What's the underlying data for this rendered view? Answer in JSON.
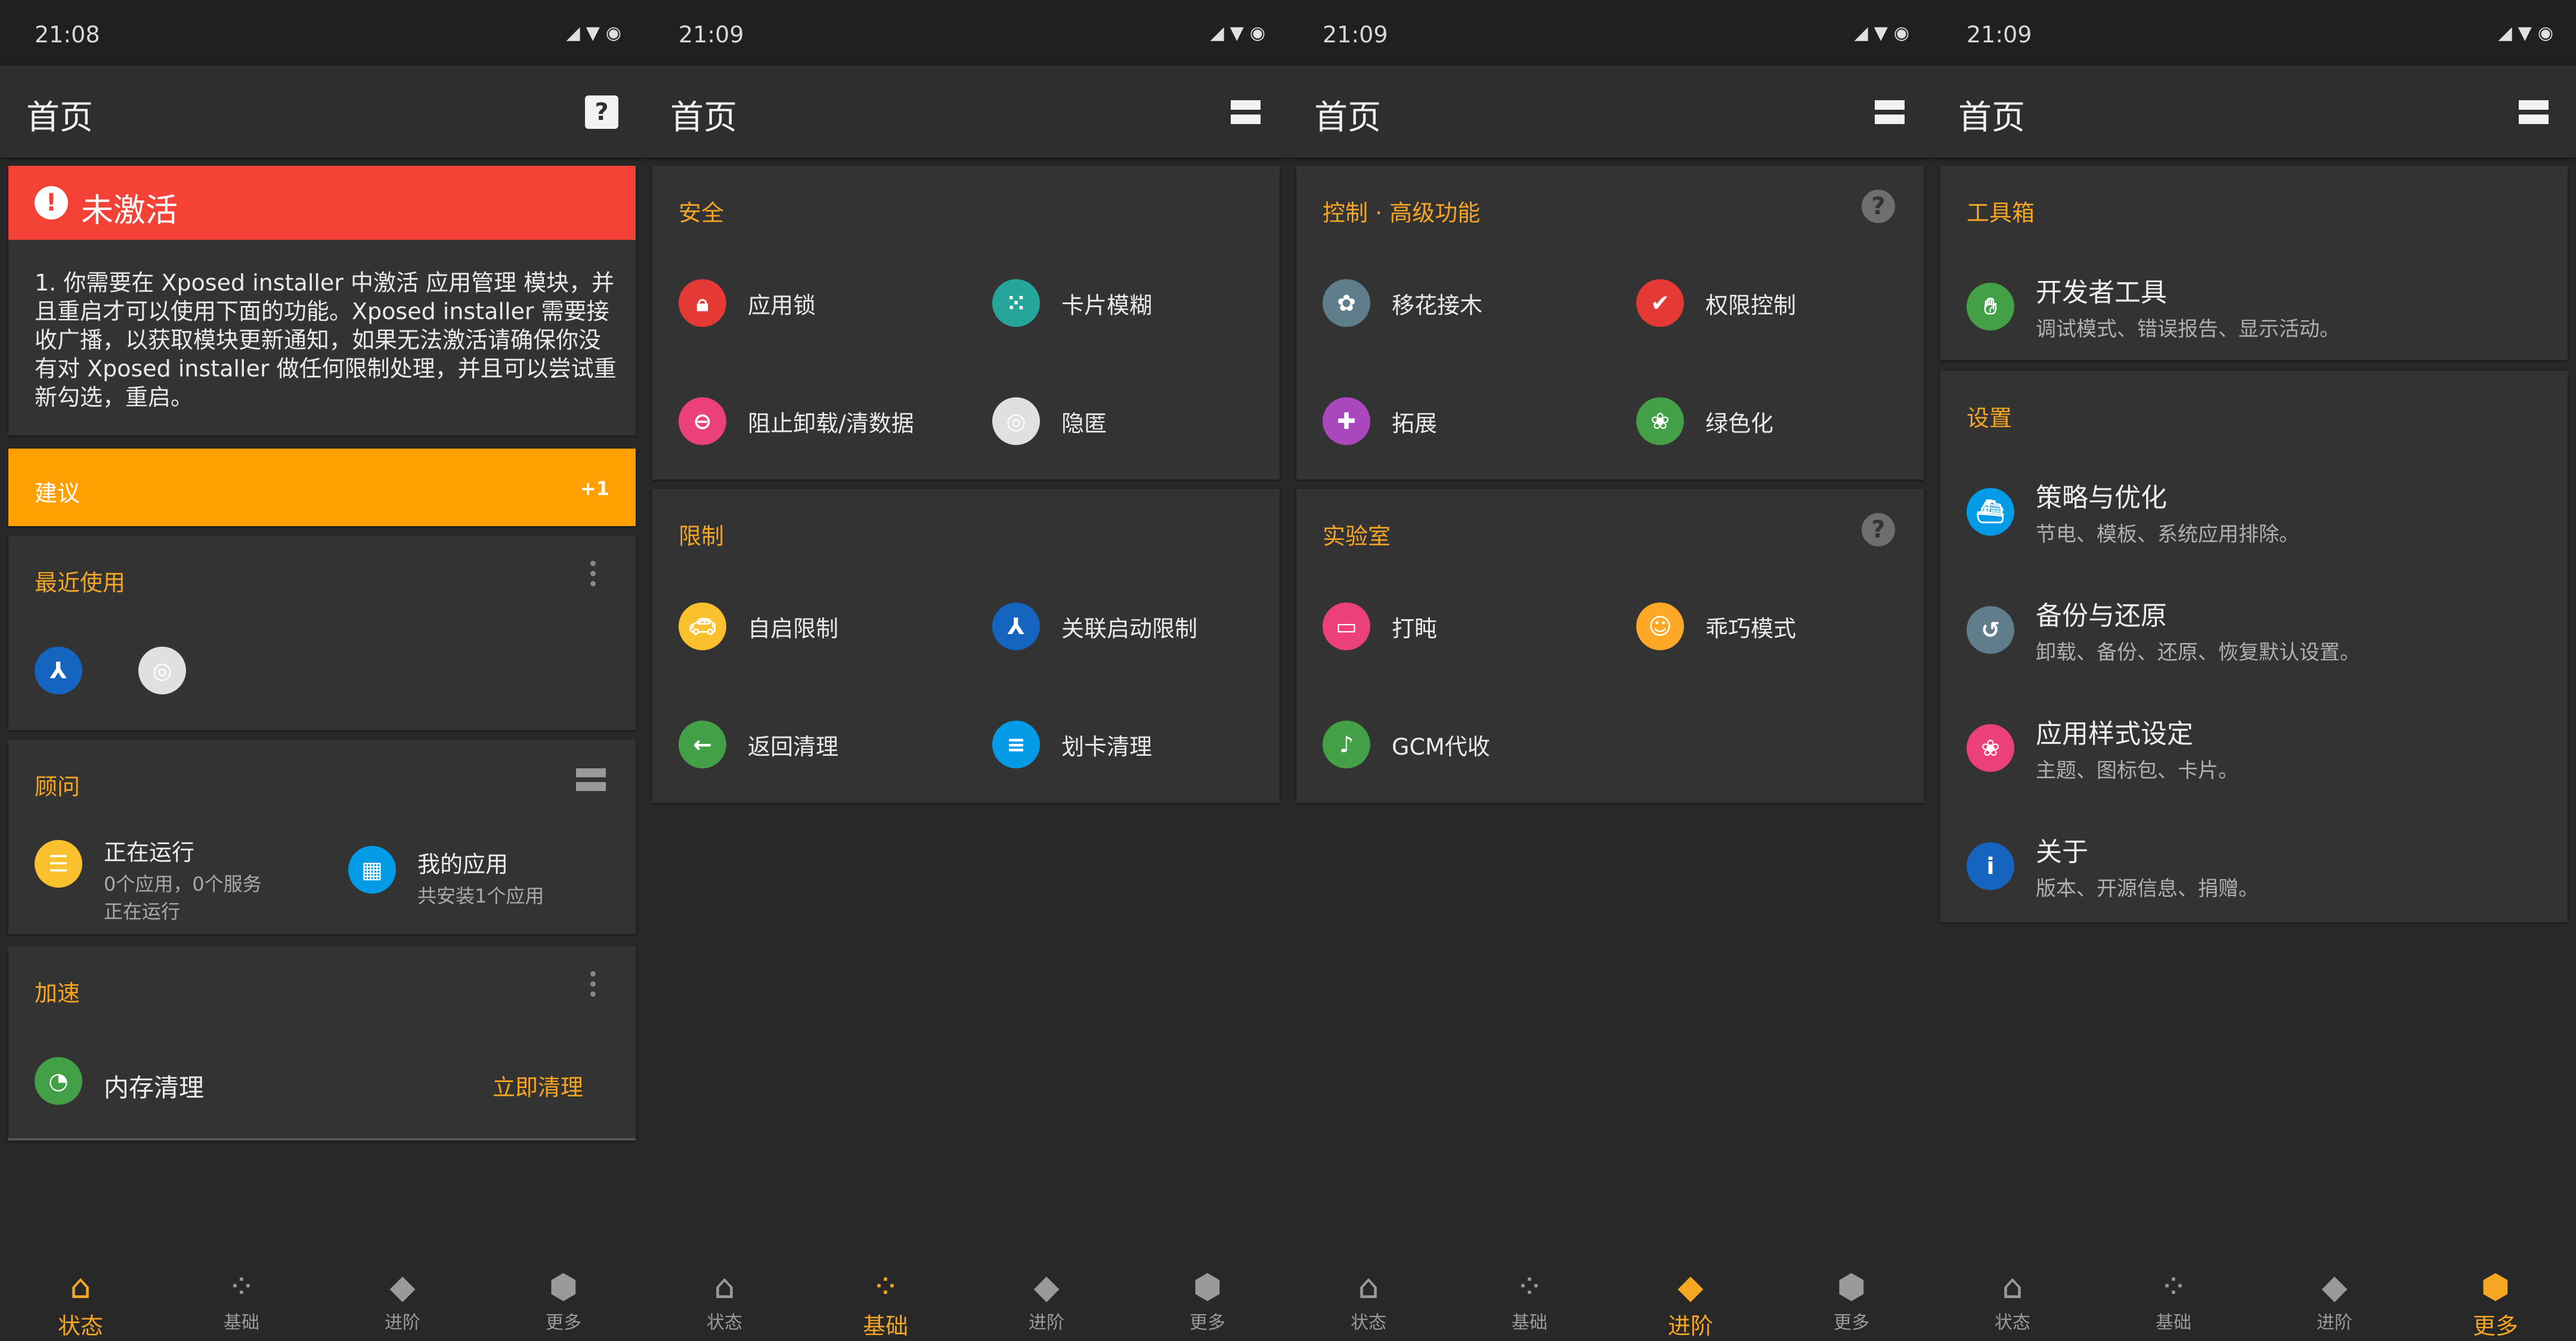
{
  "screens": [
    {
      "time": "21:08",
      "title": "首页",
      "banner": {
        "title": "未激活",
        "body": "1. 你需要在 Xposed installer 中激活 应用管理 模块，并且重启才可以使用下面的功能。Xposed installer 需要接收广播，以获取模块更新通知，如果无法激活请确保你没有对 Xposed installer 做任何限制处理，并且可以尝试重新勾选，重启。"
      },
      "suggest": {
        "label": "建议",
        "count": "+1"
      },
      "recent": {
        "title": "最近使用"
      },
      "advisor": {
        "title": "顾问",
        "running": {
          "title": "正在运行",
          "line1": "0个应用，0个服务",
          "line2": "正在运行"
        },
        "myapps": {
          "title": "我的应用",
          "line1": "共安装1个应用"
        }
      },
      "boost": {
        "title": "加速",
        "item": "内存清理",
        "action": "立即清理"
      }
    },
    {
      "time": "21:09",
      "title": "首页",
      "security": {
        "title": "安全",
        "items": [
          "应用锁",
          "卡片模糊",
          "阻止卸载/清数据",
          "隐匿"
        ]
      },
      "limit": {
        "title": "限制",
        "items": [
          "自启限制",
          "关联启动限制",
          "返回清理",
          "划卡清理"
        ]
      }
    },
    {
      "time": "21:09",
      "title": "首页",
      "control": {
        "title": "控制 · 高级功能",
        "items": [
          "移花接木",
          "权限控制",
          "拓展",
          "绿色化"
        ]
      },
      "lab": {
        "title": "实验室",
        "items": [
          "打盹",
          "乖巧模式",
          "GCM代收"
        ]
      }
    },
    {
      "time": "21:09",
      "title": "首页",
      "toolbox": {
        "title": "工具箱",
        "items": [
          {
            "title": "开发者工具",
            "sub": "调试模式、错误报告、显示活动。"
          }
        ]
      },
      "settings": {
        "title": "设置",
        "items": [
          {
            "title": "策略与优化",
            "sub": "节电、模板、系统应用排除。"
          },
          {
            "title": "备份与还原",
            "sub": "卸载、备份、还原、恢复默认设置。"
          },
          {
            "title": "应用样式设定",
            "sub": "主题、图标包、卡片。"
          },
          {
            "title": "关于",
            "sub": "版本、开源信息、捐赠。"
          }
        ]
      }
    }
  ],
  "nav": [
    "状态",
    "基础",
    "进阶",
    "更多"
  ],
  "colors": {
    "accent": "#f5a623",
    "danger": "#f44336",
    "suggest": "#ffa000",
    "card": "#333333"
  }
}
